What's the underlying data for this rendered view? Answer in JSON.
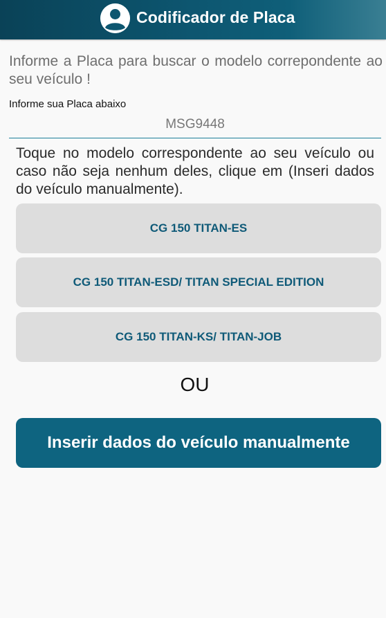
{
  "header": {
    "title": "Codificador de Placa",
    "avatar_icon": "account-circle-icon"
  },
  "colors": {
    "header_start": "#0a4257",
    "header_end": "#3a7f93",
    "accent": "#0e6480",
    "option_background": "#dddddd",
    "option_text": "#0f5a78"
  },
  "form": {
    "instruction": "Informe a Placa para buscar o modelo correpondente ao seu veículo !",
    "plate_label": "Informe sua Placa abaixo",
    "plate_value": "MSG9448"
  },
  "results": {
    "help_text": "Toque no modelo correspondente ao seu veículo ou caso não seja nenhum deles, clique em (Inseri dados do veículo manualmente).",
    "models": [
      {
        "label": "CG 150 TITAN-ES"
      },
      {
        "label": "CG 150 TITAN-ESD/ TITAN SPECIAL EDITION"
      },
      {
        "label": "CG 150 TITAN-KS/ TITAN-JOB"
      }
    ],
    "or_text": "OU",
    "manual_button_label": "Inserir dados do veículo manualmente"
  }
}
